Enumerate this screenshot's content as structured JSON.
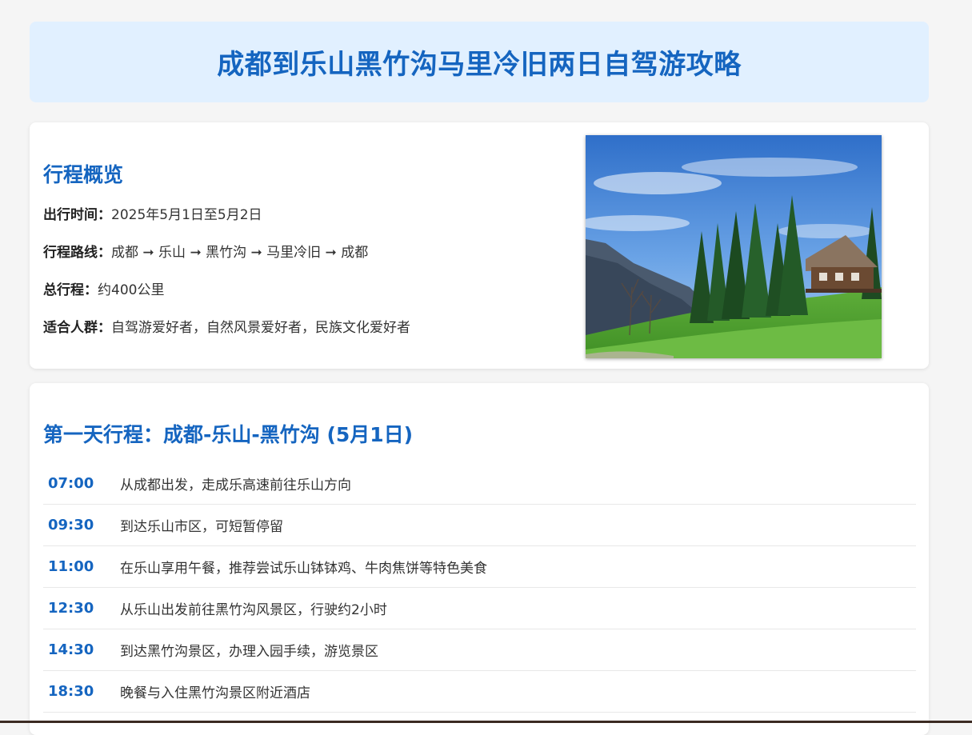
{
  "header": {
    "title": "成都到乐山黑竹沟马里冷旧两日自驾游攻略"
  },
  "overview": {
    "title": "行程概览",
    "items": [
      {
        "label": "出行时间：",
        "value": "2025年5月1日至5月2日"
      },
      {
        "label": "行程路线：",
        "value": "成都 ➞ 乐山 ➞ 黑竹沟 ➞ 马里冷旧 ➞ 成都"
      },
      {
        "label": "总行程：",
        "value": "约400公里"
      },
      {
        "label": "适合人群：",
        "value": "自驾游爱好者，自然风景爱好者，民族文化爱好者"
      }
    ],
    "photo_icon": "mountain-forest-cabin-photo"
  },
  "day1": {
    "title": "第一天行程：成都-乐山-黑竹沟 (5月1日)",
    "schedule": [
      {
        "time": "07:00",
        "desc": "从成都出发，走成乐高速前往乐山方向"
      },
      {
        "time": "09:30",
        "desc": "到达乐山市区，可短暂停留"
      },
      {
        "time": "11:00",
        "desc": "在乐山享用午餐，推荐尝试乐山钵钵鸡、牛肉焦饼等特色美食"
      },
      {
        "time": "12:30",
        "desc": "从乐山出发前往黑竹沟风景区，行驶约2小时"
      },
      {
        "time": "14:30",
        "desc": "到达黑竹沟景区，办理入园手续，游览景区"
      },
      {
        "time": "18:30",
        "desc": "晚餐与入住黑竹沟景区附近酒店"
      }
    ]
  },
  "colors": {
    "accent": "#1565c0",
    "header_bg": "#e1f0ff",
    "page_bg": "#f5f5f5"
  }
}
